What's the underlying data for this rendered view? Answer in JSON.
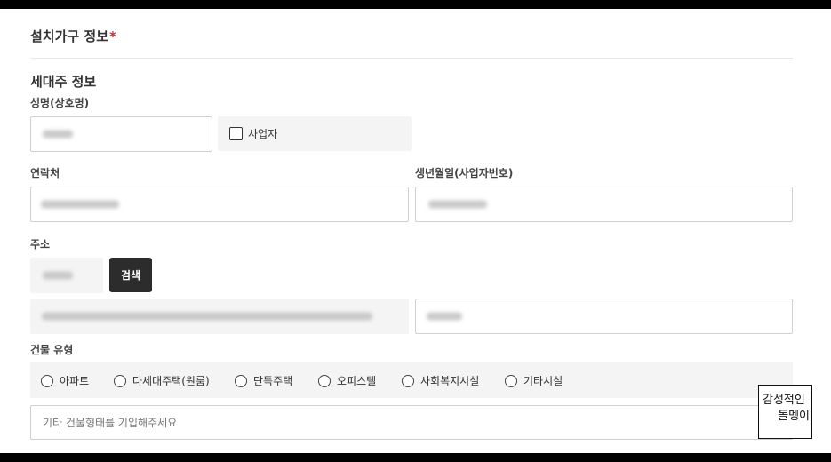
{
  "section": {
    "title": "설치가구 정보",
    "required_mark": "*"
  },
  "householder": {
    "title": "세대주 정보",
    "name_label": "성명(상호명)",
    "business_checkbox_label": "사업자",
    "contact_label": "연락처",
    "birth_label": "생년월일(사업자번호)",
    "address_label": "주소",
    "search_button": "검색"
  },
  "building": {
    "label": "건물 유형",
    "options": [
      "아파트",
      "다세대주택(원룸)",
      "단독주택",
      "오피스텔",
      "사회복지시설",
      "기타시설"
    ],
    "other_placeholder": "기타 건물형태를 기입해주세요"
  },
  "watermark": {
    "line1": "감성적인",
    "line2": "돌멩이"
  }
}
